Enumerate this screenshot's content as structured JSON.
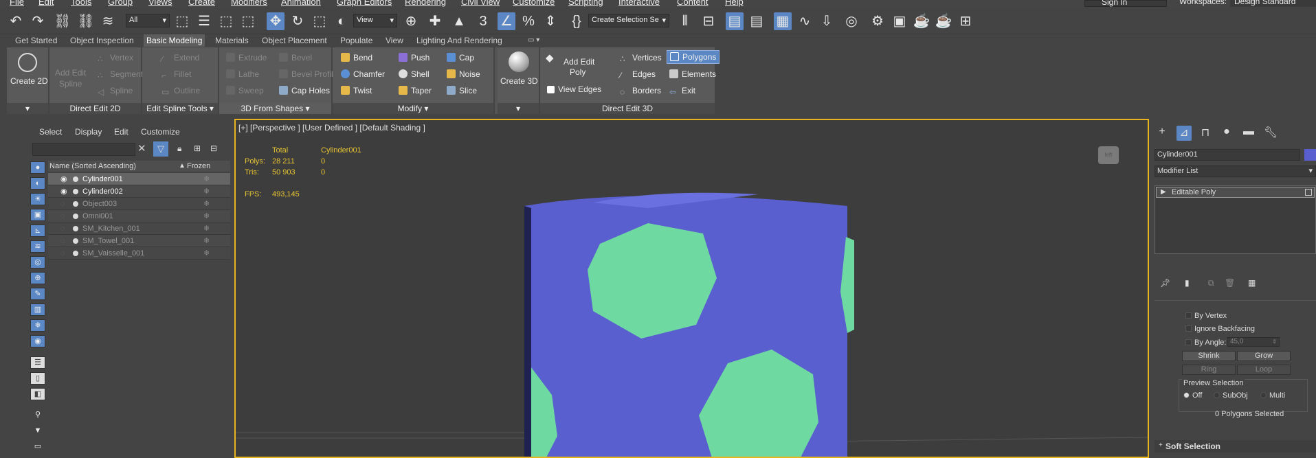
{
  "menu": [
    "File",
    "Edit",
    "Tools",
    "Group",
    "Views",
    "Create",
    "Modifiers",
    "Animation",
    "Graph Editors",
    "Rendering",
    "Civil View",
    "Customize",
    "Scripting",
    "Interactive",
    "Content",
    "Help"
  ],
  "header": {
    "sign_in": "Sign In",
    "workspaces_label": "Workspaces:",
    "workspace_value": "Design Standard"
  },
  "toolbar": {
    "filter_value": "All",
    "view_value": "View",
    "selection_set_placeholder": "Create Selection Se"
  },
  "ribbon_tabs": [
    "Get Started",
    "Object Inspection",
    "Basic Modeling",
    "Materials",
    "Object Placement",
    "Populate",
    "View",
    "Lighting And Rendering"
  ],
  "ribbon": {
    "create2d": "Create 2D",
    "direct_edit_2d": {
      "add_edit_spline_1": "Add Edit",
      "add_edit_spline_2": "Spline",
      "vertex": "Vertex",
      "segment": "Segment",
      "spline": "Spline",
      "footer": "Direct Edit 2D"
    },
    "edit_spline_tools": {
      "extend": "Extend",
      "fillet": "Fillet",
      "outline": "Outline",
      "footer": "Edit Spline Tools"
    },
    "from_shapes": {
      "extrude": "Extrude",
      "lathe": "Lathe",
      "sweep": "Sweep",
      "bevel": "Bevel",
      "bevel_profile": "Bevel Profile",
      "cap_holes": "Cap Holes",
      "footer": "3D From Shapes"
    },
    "modify": {
      "bend": "Bend",
      "chamfer": "Chamfer",
      "twist": "Twist",
      "push": "Push",
      "shell": "Shell",
      "taper": "Taper",
      "cap": "Cap",
      "noise": "Noise",
      "slice": "Slice",
      "footer": "Modify"
    },
    "create3d": "Create 3D",
    "direct_edit_3d": {
      "add_edit_poly_1": "Add Edit",
      "add_edit_poly_2": "Poly",
      "view_edges": "View Edges",
      "vertices": "Vertices",
      "edges": "Edges",
      "borders": "Borders",
      "polygons": "Polygons",
      "elements": "Elements",
      "exit": "Exit",
      "footer": "Direct Edit 3D"
    }
  },
  "scene_explorer": {
    "menu": [
      "Select",
      "Display",
      "Edit",
      "Customize"
    ],
    "col_name": "Name (Sorted Ascending)",
    "col_frozen": "Frozen",
    "rows": [
      {
        "name": "Cylinder001",
        "visible": true,
        "selected": true
      },
      {
        "name": "Cylinder002",
        "visible": true,
        "selected": false
      },
      {
        "name": "Object003",
        "visible": false,
        "selected": false
      },
      {
        "name": "Omni001",
        "visible": false,
        "selected": false
      },
      {
        "name": "SM_Kitchen_001",
        "visible": false,
        "selected": false
      },
      {
        "name": "SM_Towel_001",
        "visible": false,
        "selected": false
      },
      {
        "name": "SM_Vaisselle_001",
        "visible": false,
        "selected": false
      }
    ]
  },
  "viewport": {
    "label": "[+] [Perspective ] [User Defined ] [Default Shading ]",
    "stats_total": "Total",
    "stats_object": "Cylinder001",
    "polys_label": "Polys:",
    "polys_total": "28 211",
    "polys_obj": "0",
    "tris_label": "Tris:",
    "tris_total": "50 903",
    "tris_obj": "0",
    "fps_label": "FPS:",
    "fps_value": "493,145",
    "nav_cube": "left"
  },
  "command_panel": {
    "object_name": "Cylinder001",
    "modifier_list": "Modifier List",
    "stack_item": "Editable Poly",
    "by_vertex": "By Vertex",
    "ignore_backfacing": "Ignore Backfacing",
    "by_angle": "By Angle:",
    "angle_value": "45,0",
    "shrink": "Shrink",
    "grow": "Grow",
    "ring": "Ring",
    "loop": "Loop",
    "preview_selection": "Preview Selection",
    "opt_off": "Off",
    "opt_subobj": "SubObj",
    "opt_multi": "Multi",
    "selected_count": "0 Polygons Selected",
    "soft_selection": "Soft Selection"
  },
  "colors": {
    "accent": "#5b87c5",
    "viewport_border": "#e8b51c",
    "cylinder": "#5a5fd0",
    "hex": "#6ed9a0",
    "stats": "#e6c431"
  }
}
